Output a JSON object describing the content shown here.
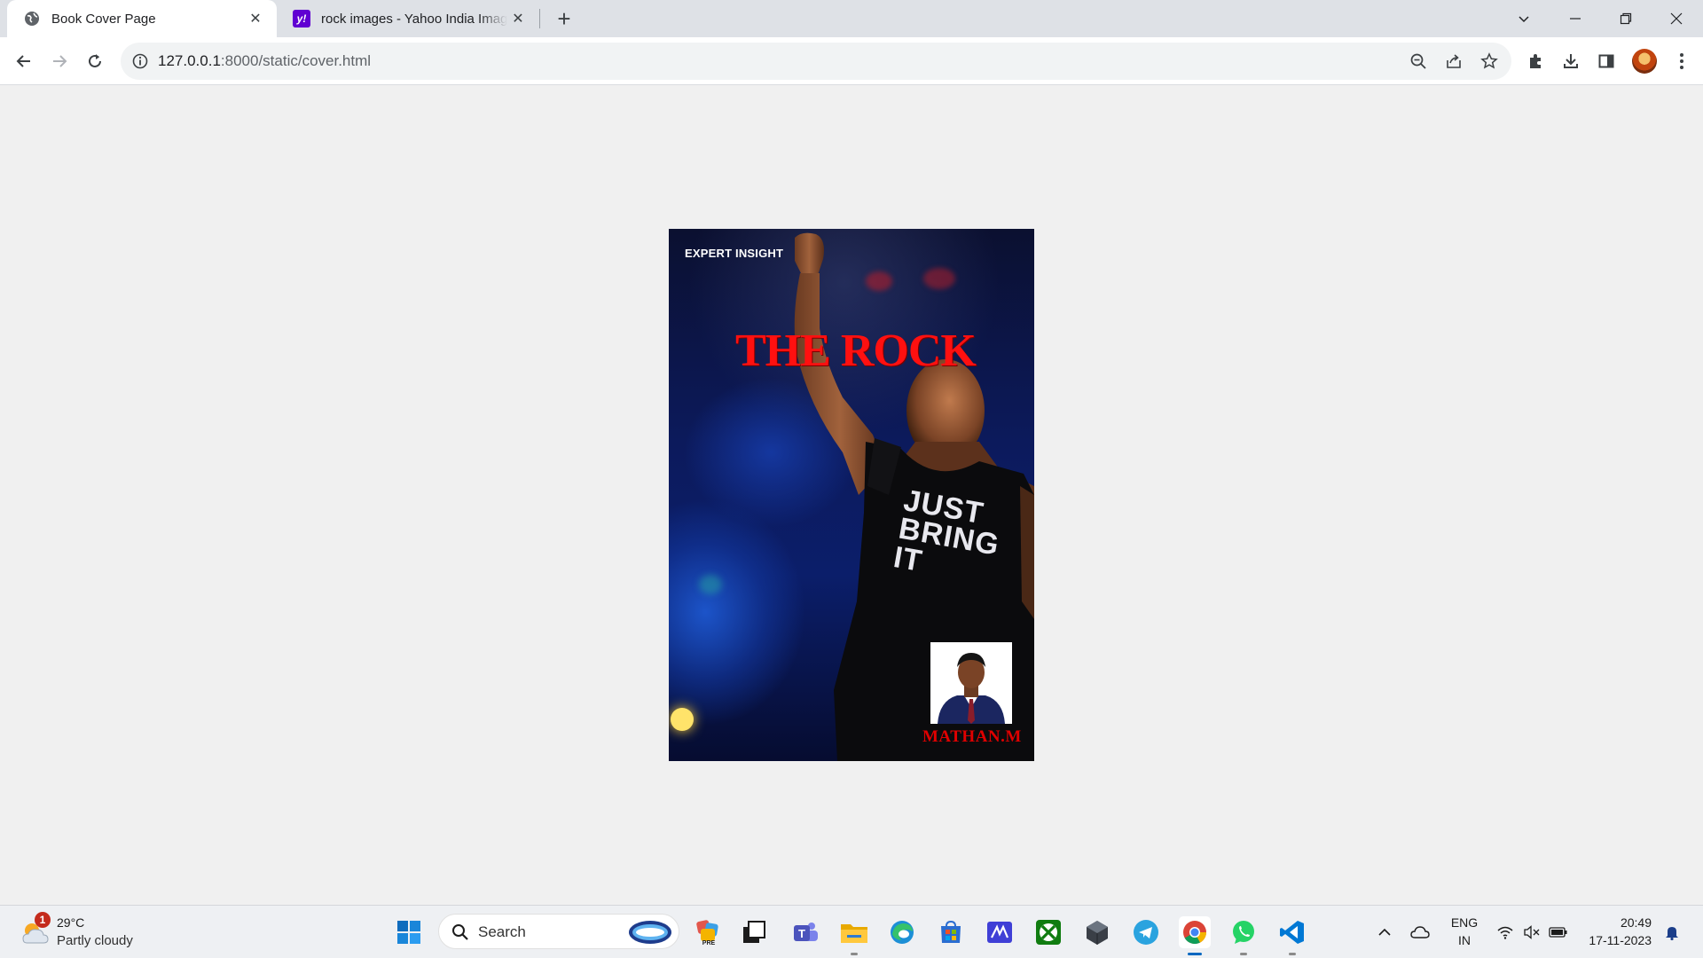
{
  "browser": {
    "tabs": [
      {
        "title": "Book Cover Page",
        "active": true,
        "favicon": "globe-icon"
      },
      {
        "title": "rock images - Yahoo India Image Search",
        "active": false,
        "favicon": "yahoo-icon",
        "favicon_text": "y!"
      }
    ],
    "address": {
      "host": "127.0.0.1",
      "rest": ":8000/static/cover.html"
    },
    "colors": {
      "tabstrip": "#dee1e6",
      "toolbar": "#ffffff",
      "omnibox": "#f1f3f4"
    }
  },
  "page": {
    "background": "#f0f0f0",
    "cover": {
      "top_label": "EXPERT INSIGHT",
      "title": "THE ROCK",
      "shirt_lines": [
        "JUST",
        "BRING",
        "IT"
      ],
      "author": "MATHAN.M",
      "title_color": "#ff1010",
      "author_color": "#e00000"
    }
  },
  "taskbar": {
    "weather": {
      "temp": "29°C",
      "condition": "Partly cloudy",
      "badge": "1"
    },
    "search_label": "Search",
    "apps": [
      "start-icon",
      "search-icon",
      "copilot-icon",
      "dev-preview-icon",
      "task-view-icon",
      "teams-icon",
      "file-explorer-icon",
      "edge-icon",
      "store-icon",
      "math-app-icon",
      "xbox-icon",
      "cube-app-icon",
      "telegram-icon",
      "chrome-icon",
      "whatsapp-icon",
      "vscode-icon"
    ],
    "tray": {
      "lang_top": "ENG",
      "lang_bottom": "IN",
      "time": "20:49",
      "date": "17-11-2023"
    }
  }
}
